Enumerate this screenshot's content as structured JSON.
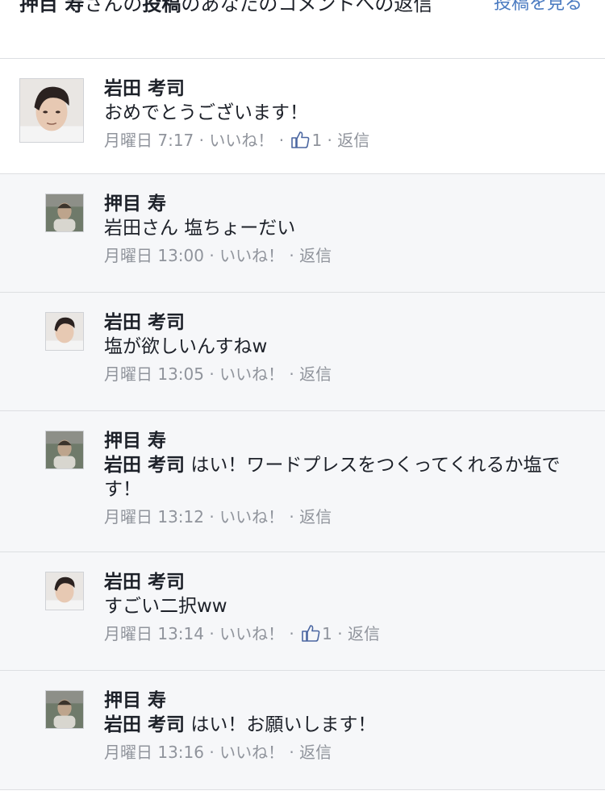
{
  "header": {
    "notice_owner": "押目 寿",
    "notice_mid": "さんの",
    "notice_post": "投稿",
    "notice_rest": "のあなたのコメントへの返信",
    "see_post_label": "投稿を見る"
  },
  "comments": [
    {
      "name": "岩田 考司",
      "tag": "",
      "text": "おめでとうございます！",
      "time": "月曜日 7:17",
      "like_label": "いいね！",
      "like_count": "1",
      "reply_label": "返信"
    },
    {
      "name": "押目 寿",
      "tag": "",
      "text": "岩田さん  塩ちょーだい",
      "time": "月曜日 13:00",
      "like_label": "いいね！",
      "like_count": "",
      "reply_label": "返信"
    },
    {
      "name": "岩田 考司",
      "tag": "",
      "text": "塩が欲しいんすねw",
      "time": "月曜日 13:05",
      "like_label": "いいね！",
      "like_count": "",
      "reply_label": "返信"
    },
    {
      "name": "押目 寿",
      "tag": "岩田 考司",
      "text": "はい！ワードプレスをつくってくれるか塩です！",
      "time": "月曜日 13:12",
      "like_label": "いいね！",
      "like_count": "",
      "reply_label": "返信"
    },
    {
      "name": "岩田 考司",
      "tag": "",
      "text": "すごい二択ww",
      "time": "月曜日 13:14",
      "like_label": "いいね！",
      "like_count": "1",
      "reply_label": "返信"
    },
    {
      "name": "押目 寿",
      "tag": "岩田 考司",
      "text": "はい！お願いします！",
      "time": "月曜日 13:16",
      "like_label": "いいね！",
      "like_count": "",
      "reply_label": "返信"
    }
  ],
  "colors": {
    "link": "#4b7bc1",
    "meta_text": "#90949c",
    "reply_background": "#f6f7f9",
    "like_icon": "#4b67a1"
  },
  "icons": {
    "like": "thumbs-up-icon",
    "avatar": "user-photo"
  }
}
